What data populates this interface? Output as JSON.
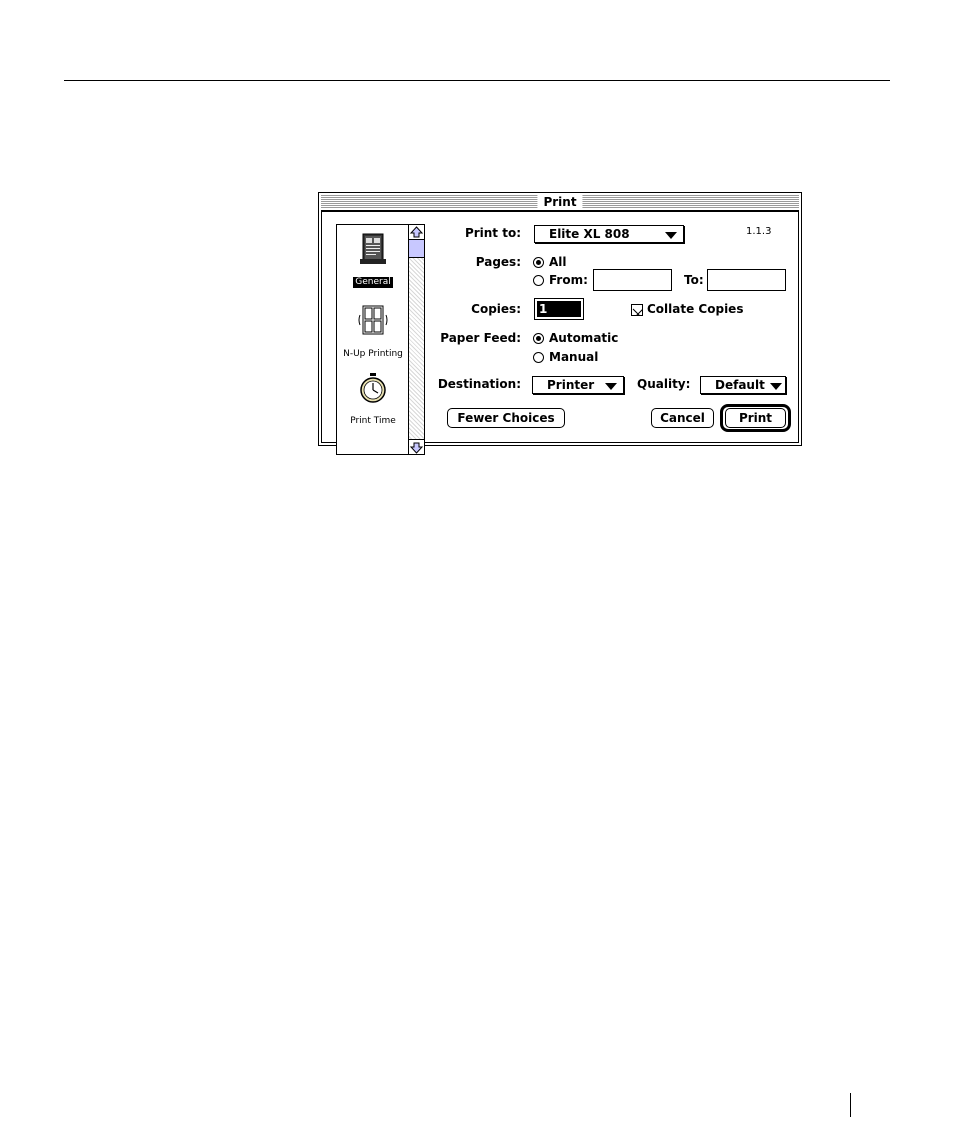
{
  "dialog": {
    "title": "Print",
    "version": "1.1.3"
  },
  "panels": {
    "items": [
      {
        "label": "General",
        "icon": "general-document-icon",
        "selected": true
      },
      {
        "label": "N-Up Printing",
        "icon": "n-up-printing-icon",
        "selected": false
      },
      {
        "label": "Print Time",
        "icon": "stopwatch-icon",
        "selected": false
      }
    ]
  },
  "form": {
    "print_to": {
      "label": "Print to:",
      "value": "Elite XL 808"
    },
    "pages": {
      "label": "Pages:",
      "all_label": "All",
      "from_label": "From:",
      "to_label": "To:",
      "from_value": "",
      "to_value": "",
      "selected": "All"
    },
    "copies": {
      "label": "Copies:",
      "value": "1"
    },
    "collate": {
      "label": "Collate Copies",
      "checked": true
    },
    "paper_feed": {
      "label": "Paper Feed:",
      "automatic_label": "Automatic",
      "manual_label": "Manual",
      "selected": "Automatic"
    },
    "destination": {
      "label": "Destination:",
      "value": "Printer"
    },
    "quality": {
      "label": "Quality:",
      "value": "Default"
    }
  },
  "buttons": {
    "fewer_choices": "Fewer Choices",
    "cancel": "Cancel",
    "print": "Print"
  }
}
